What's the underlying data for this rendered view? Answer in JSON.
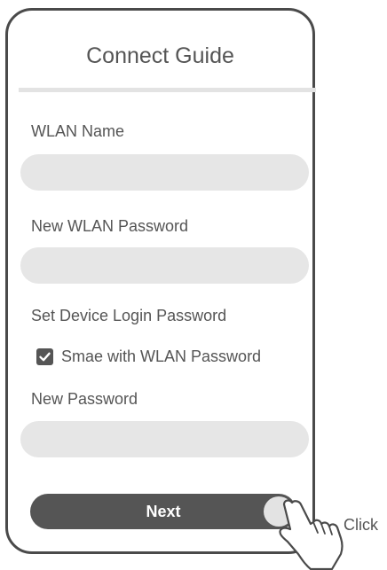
{
  "header": {
    "title": "Connect Guide"
  },
  "form": {
    "wlan_name": {
      "label": "WLAN Name",
      "value": ""
    },
    "wlan_password": {
      "label": "New WLAN Password",
      "value": ""
    },
    "device_login": {
      "label": "Set Device Login Password"
    },
    "same_as_wlan": {
      "label": "Smae with WLAN Password",
      "checked": true
    },
    "new_password": {
      "label": "New Password",
      "value": ""
    }
  },
  "actions": {
    "next_label": "Next"
  },
  "annotation": {
    "click_label": "Click",
    "icon": "pointing-hand-icon"
  },
  "colors": {
    "frame": "#4a4a4a",
    "text": "#555555",
    "field_bg": "#e6e6e6",
    "button_bg": "#555555",
    "button_text": "#ffffff"
  }
}
